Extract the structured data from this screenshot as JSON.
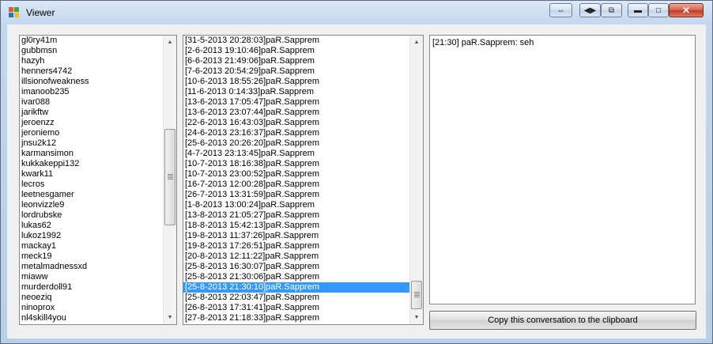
{
  "window": {
    "title": "Viewer"
  },
  "users": [
    "gl0ry41m",
    "gubbmsn",
    "hazyh",
    "henners4742",
    "illsionofweakness",
    "imanoob235",
    "ivar088",
    "jarikftw",
    "jeroenzz",
    "jeroniemo",
    "jnsu2k12",
    "karmansimon",
    "kukkakeppi132",
    "kwark11",
    "lecros",
    "leetnesgamer",
    "leonvizzle9",
    "lordrubske",
    "lukas62",
    "lukoz1992",
    "mackay1",
    "meck19",
    "metalmadnessxd",
    "miaww",
    "murderdoll91",
    "neoeziq",
    "ninoprox",
    "nl4skill4you"
  ],
  "conversations": [
    "[31-5-2013 20:28:03]paR.Sapprem",
    "[2-6-2013 19:10:46]paR.Sapprem",
    "[6-6-2013 21:49:06]paR.Sapprem",
    "[7-6-2013 20:54:29]paR.Sapprem",
    "[10-6-2013 18:55:26]paR.Sapprem",
    "[11-6-2013 0:14:33]paR.Sapprem",
    "[13-6-2013 17:05:47]paR.Sapprem",
    "[13-6-2013 23:07:44]paR.Sapprem",
    "[22-6-2013 16:43:03]paR.Sapprem",
    "[24-6-2013 23:16:37]paR.Sapprem",
    "[25-6-2013 20:26:20]paR.Sapprem",
    "[4-7-2013 23:13:45]paR.Sapprem",
    "[10-7-2013 18:16:38]paR.Sapprem",
    "[10-7-2013 23:00:52]paR.Sapprem",
    "[16-7-2013 12:00:28]paR.Sapprem",
    "[26-7-2013 13:31:59]paR.Sapprem",
    "[1-8-2013 13:00:24]paR.Sapprem",
    "[13-8-2013 21:05:27]paR.Sapprem",
    "[18-8-2013 15:42:13]paR.Sapprem",
    "[19-8-2013 11:37:26]paR.Sapprem",
    "[19-8-2013 17:26:51]paR.Sapprem",
    "[20-8-2013 12:11:22]paR.Sapprem",
    "[25-8-2013 16:30:07]paR.Sapprem",
    "[25-8-2013 21:30:06]paR.Sapprem",
    "[25-8-2013 21:30:10]paR.Sapprem",
    "[25-8-2013 22:03:47]paR.Sapprem",
    "[26-8-2013 17:31:41]paR.Sapprem",
    "[27-8-2013 21:18:33]paR.Sapprem"
  ],
  "selected_conversation_index": 24,
  "message": "[21:30] paR.Sapprem: seh",
  "copy_button_label": "Copy this conversation to the clipboard",
  "icons": {
    "title_buttons": [
      "resize-icon",
      "code-icon",
      "copy-icon",
      "minimize-icon",
      "maximize-icon",
      "close-icon"
    ]
  },
  "colors": {
    "selection": "#3399ff",
    "title_bar": "#c3d7ee"
  }
}
